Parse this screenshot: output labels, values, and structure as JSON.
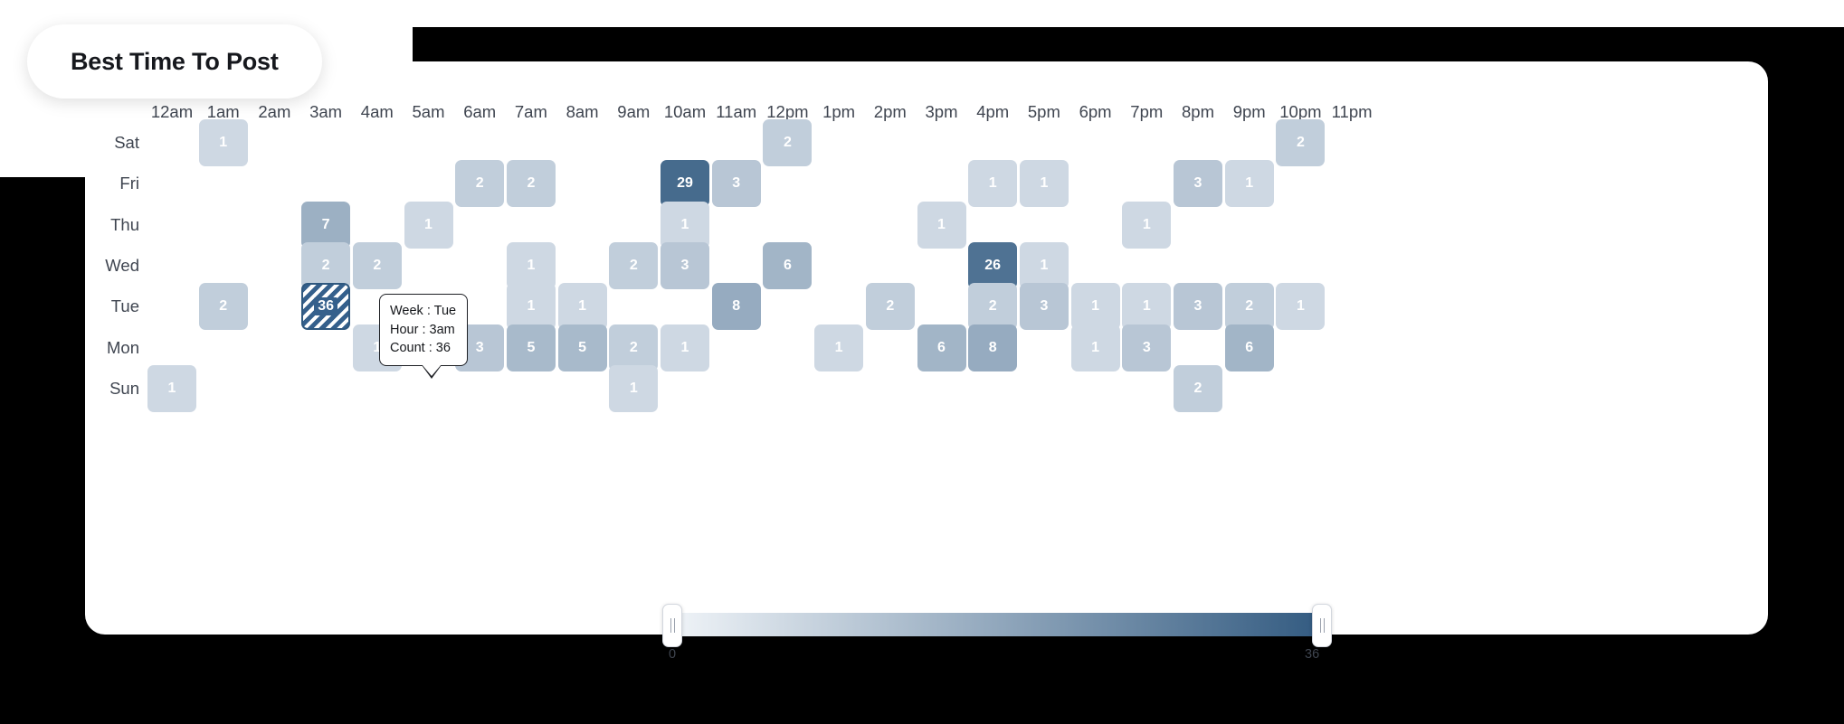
{
  "title": "Best Time To Post",
  "axes": {
    "hours": [
      "12am",
      "1am",
      "2am",
      "3am",
      "4am",
      "5am",
      "6am",
      "7am",
      "8am",
      "9am",
      "10am",
      "11am",
      "12pm",
      "1pm",
      "2pm",
      "3pm",
      "4pm",
      "5pm",
      "6pm",
      "7pm",
      "8pm",
      "9pm",
      "10pm",
      "11pm"
    ],
    "days": [
      "Sat",
      "Fri",
      "Thu",
      "Wed",
      "Tue",
      "Mon",
      "Sun"
    ]
  },
  "tooltip": {
    "week_line": "Week : Tue",
    "hour_line": "Hour : 3am",
    "count_line": "Count : 36"
  },
  "legend": {
    "min_label": "0",
    "max_label": "36",
    "gradient_start": "#f0f4f8",
    "gradient_end": "#335b81"
  },
  "colors": {
    "max_cell": "#5d7fa3",
    "selected_border": "#2f587f",
    "selected_stripe": "#35608c",
    "text_on_cell": "#ffffff",
    "axis_text": "#3f4550",
    "card_bg": "#ffffff",
    "page_bg": "#000000"
  },
  "chart_data": {
    "type": "heatmap",
    "title": "Best Time To Post",
    "xlabel": "",
    "ylabel": "",
    "x_categories": [
      "12am",
      "1am",
      "2am",
      "3am",
      "4am",
      "5am",
      "6am",
      "7am",
      "8am",
      "9am",
      "10am",
      "11am",
      "12pm",
      "1pm",
      "2pm",
      "3pm",
      "4pm",
      "5pm",
      "6pm",
      "7pm",
      "8pm",
      "9pm",
      "10pm",
      "11pm"
    ],
    "y_categories": [
      "Sat",
      "Fri",
      "Thu",
      "Wed",
      "Tue",
      "Mon",
      "Sun"
    ],
    "value_range": [
      0,
      36
    ],
    "selected_cell": {
      "day": "Tue",
      "hour": "3am",
      "value": 36
    },
    "cells": [
      {
        "day": "Sat",
        "hour": "1am",
        "value": 1
      },
      {
        "day": "Sat",
        "hour": "12pm",
        "value": 2
      },
      {
        "day": "Sat",
        "hour": "10pm",
        "value": 2
      },
      {
        "day": "Fri",
        "hour": "6am",
        "value": 2
      },
      {
        "day": "Fri",
        "hour": "7am",
        "value": 2
      },
      {
        "day": "Fri",
        "hour": "10am",
        "value": 29
      },
      {
        "day": "Fri",
        "hour": "11am",
        "value": 3
      },
      {
        "day": "Fri",
        "hour": "4pm",
        "value": 1
      },
      {
        "day": "Fri",
        "hour": "5pm",
        "value": 1
      },
      {
        "day": "Fri",
        "hour": "8pm",
        "value": 3
      },
      {
        "day": "Fri",
        "hour": "9pm",
        "value": 1
      },
      {
        "day": "Thu",
        "hour": "3am",
        "value": 7
      },
      {
        "day": "Thu",
        "hour": "5am",
        "value": 1
      },
      {
        "day": "Thu",
        "hour": "10am",
        "value": 1
      },
      {
        "day": "Thu",
        "hour": "3pm",
        "value": 1
      },
      {
        "day": "Thu",
        "hour": "7pm",
        "value": 1
      },
      {
        "day": "Wed",
        "hour": "3am",
        "value": 2
      },
      {
        "day": "Wed",
        "hour": "4am",
        "value": 2
      },
      {
        "day": "Wed",
        "hour": "7am",
        "value": 1
      },
      {
        "day": "Wed",
        "hour": "9am",
        "value": 2
      },
      {
        "day": "Wed",
        "hour": "10am",
        "value": 3
      },
      {
        "day": "Wed",
        "hour": "12pm",
        "value": 6
      },
      {
        "day": "Wed",
        "hour": "4pm",
        "value": 26
      },
      {
        "day": "Wed",
        "hour": "5pm",
        "value": 1
      },
      {
        "day": "Tue",
        "hour": "1am",
        "value": 2
      },
      {
        "day": "Tue",
        "hour": "3am",
        "value": 36
      },
      {
        "day": "Tue",
        "hour": "7am",
        "value": 1
      },
      {
        "day": "Tue",
        "hour": "8am",
        "value": 1
      },
      {
        "day": "Tue",
        "hour": "11am",
        "value": 8
      },
      {
        "day": "Tue",
        "hour": "2pm",
        "value": 2
      },
      {
        "day": "Tue",
        "hour": "4pm",
        "value": 2
      },
      {
        "day": "Tue",
        "hour": "5pm",
        "value": 3
      },
      {
        "day": "Tue",
        "hour": "6pm",
        "value": 1
      },
      {
        "day": "Tue",
        "hour": "7pm",
        "value": 1
      },
      {
        "day": "Tue",
        "hour": "8pm",
        "value": 3
      },
      {
        "day": "Tue",
        "hour": "9pm",
        "value": 2
      },
      {
        "day": "Tue",
        "hour": "10pm",
        "value": 1
      },
      {
        "day": "Mon",
        "hour": "4am",
        "value": 1
      },
      {
        "day": "Mon",
        "hour": "6am",
        "value": 3
      },
      {
        "day": "Mon",
        "hour": "7am",
        "value": 5
      },
      {
        "day": "Mon",
        "hour": "8am",
        "value": 5
      },
      {
        "day": "Mon",
        "hour": "9am",
        "value": 2
      },
      {
        "day": "Mon",
        "hour": "10am",
        "value": 1
      },
      {
        "day": "Mon",
        "hour": "1pm",
        "value": 1
      },
      {
        "day": "Mon",
        "hour": "3pm",
        "value": 6
      },
      {
        "day": "Mon",
        "hour": "4pm",
        "value": 8
      },
      {
        "day": "Mon",
        "hour": "6pm",
        "value": 1
      },
      {
        "day": "Mon",
        "hour": "7pm",
        "value": 3
      },
      {
        "day": "Mon",
        "hour": "9pm",
        "value": 6
      },
      {
        "day": "Sun",
        "hour": "12am",
        "value": 1
      },
      {
        "day": "Sun",
        "hour": "9am",
        "value": 1
      },
      {
        "day": "Sun",
        "hour": "8pm",
        "value": 2
      }
    ]
  }
}
